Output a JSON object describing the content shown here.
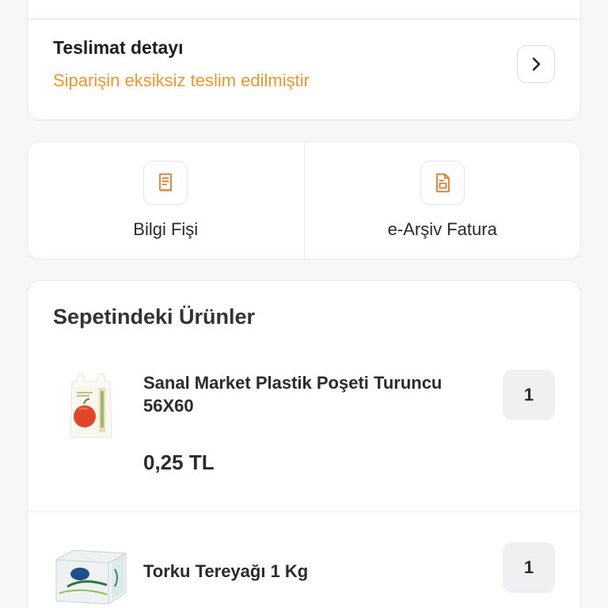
{
  "delivery": {
    "title": "Teslimat detayı",
    "status": "Siparişin eksiksiz teslim edilmiştir",
    "status_color": "#f0962b"
  },
  "documents": [
    {
      "label": "Bilgi Fişi",
      "icon": "receipt-icon"
    },
    {
      "label": "e-Arşiv Fatura",
      "icon": "invoice-document-icon"
    }
  ],
  "products": {
    "title": "Sepetindeki Ürünler",
    "items": [
      {
        "name": "Sanal Market Plastik Poşeti Turuncu 56X60",
        "price": "0,25 TL",
        "quantity": "1",
        "image": "plastic-bag-image"
      },
      {
        "name": "Torku Tereyağı 1 Kg",
        "price": "",
        "quantity": "1",
        "image": "butter-package-image"
      }
    ]
  },
  "colors": {
    "accent": "#f0962b",
    "icon_orange": "#e8782a",
    "background": "#f7f7f8"
  }
}
